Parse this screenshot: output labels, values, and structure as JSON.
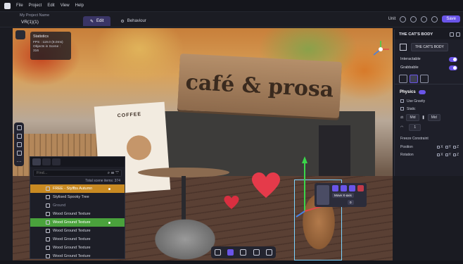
{
  "menu": {
    "items": [
      "File",
      "Project",
      "Edit",
      "View",
      "Help"
    ]
  },
  "project": {
    "label": "My Project Name",
    "name": "VR(1)(1)"
  },
  "modes": [
    {
      "label": "Edit",
      "active": true
    },
    {
      "label": "Behaviour",
      "active": false
    }
  ],
  "toolbar": {
    "unit": "Unit",
    "save_label": "Save"
  },
  "stats": {
    "title": "Statistics",
    "fps": "FPS : 119.0 (8.0ms)",
    "objects_label": "Objects in Scene :",
    "objects_count": "316"
  },
  "scene": {
    "sign_text": "café & prosa",
    "poster_text": "COFFEE"
  },
  "hierarchy": {
    "search_placeholder": "Find...",
    "total_label": "Total scene items: 374",
    "items": [
      {
        "label": "FREE - Stylfbs Autumn",
        "style": "orange"
      },
      {
        "label": "Stylised Spooky Tree",
        "style": "normal"
      },
      {
        "label": "Ground",
        "style": "group"
      },
      {
        "label": "Wood Ground Texture",
        "style": "normal"
      },
      {
        "label": "Wood Ground Texture",
        "style": "green"
      },
      {
        "label": "Wood Ground Texture",
        "style": "normal"
      },
      {
        "label": "Wood Ground Texture",
        "style": "normal"
      },
      {
        "label": "Wood Ground Texture",
        "style": "normal"
      },
      {
        "label": "Wood Ground Texture",
        "style": "normal"
      }
    ]
  },
  "inspector": {
    "title": "THE CAT'S BODY",
    "object_name": "THE CAT'S BODY",
    "interactable_label": "Interactable",
    "grabbable_label": "Grabbable",
    "physics_label": "Physics",
    "use_gravity_label": "Use Gravity",
    "static_label": "Static",
    "mass_select": "Mid",
    "drag_select": "Mid",
    "mass_value": "1",
    "freeze_title": "Freeze Constraint",
    "position_label": "Position",
    "rotation_label": "Rotation",
    "axes": [
      "X",
      "Y",
      "Z"
    ]
  },
  "mini_widget": {
    "label": "Move X-axis",
    "value": "0"
  },
  "colors": {
    "accent": "#6a55e8",
    "highlight_orange": "#c88a22",
    "highlight_green": "#4aa23c"
  }
}
